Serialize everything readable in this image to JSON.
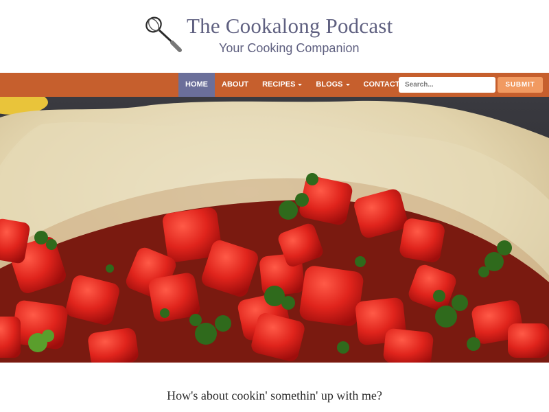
{
  "site": {
    "title": "The Cookalong Podcast",
    "tagline": "Your Cooking Companion",
    "logo_icon": "whisk-icon"
  },
  "nav": {
    "items": [
      {
        "label": "HOME",
        "active": true,
        "dropdown": false
      },
      {
        "label": "ABOUT",
        "active": false,
        "dropdown": false
      },
      {
        "label": "RECIPES",
        "active": false,
        "dropdown": true
      },
      {
        "label": "BLOGS",
        "active": false,
        "dropdown": true
      },
      {
        "label": "CONTACT",
        "active": false,
        "dropdown": false
      }
    ]
  },
  "search": {
    "placeholder": "Search...",
    "submit_label": "SUBMIT"
  },
  "hero": {
    "image_alt": "Pie crust filled with diced tomatoes and parsley"
  },
  "intro": {
    "heading": "How's about cookin' somethin' up with me?"
  },
  "colors": {
    "title": "#5f6080",
    "navbar": "#c65f2d",
    "nav_active": "#6b6f9a",
    "submit": "#f19a61"
  }
}
